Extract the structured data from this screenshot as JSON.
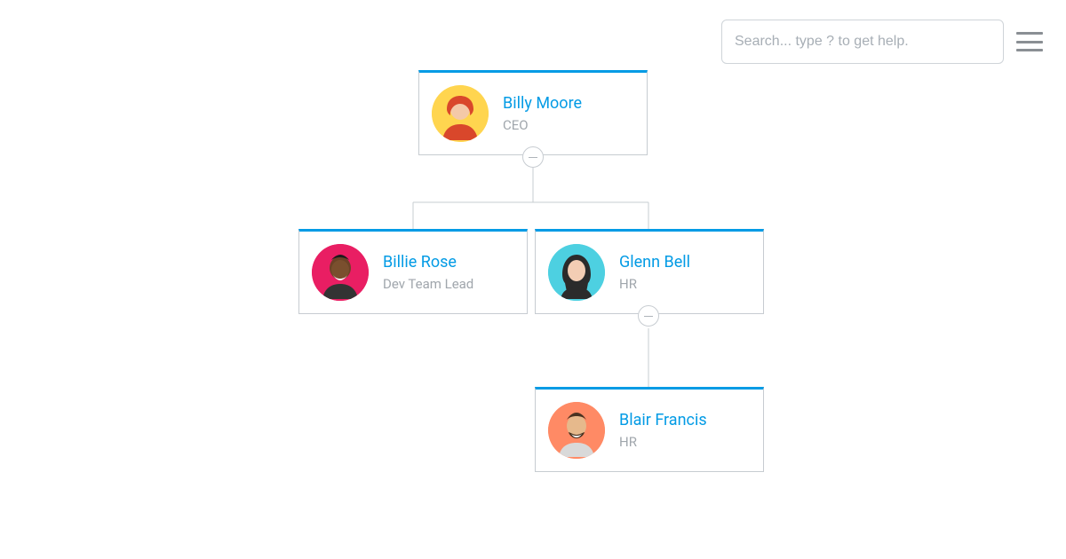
{
  "accent": "#039BE5",
  "search": {
    "placeholder": "Search... type ? to get help.",
    "value": ""
  },
  "avatar_colors": {
    "billy": "#FFD54F",
    "billie": "#E91E63",
    "glenn": "#4DD0E1",
    "blair": "#FF8A65"
  },
  "nodes": [
    {
      "id": "ceo",
      "name": "Billy Moore",
      "title": "CEO",
      "avatar": "billy"
    },
    {
      "id": "dev",
      "name": "Billie Rose",
      "title": "Dev Team Lead",
      "avatar": "billie"
    },
    {
      "id": "hr",
      "name": "Glenn Bell",
      "title": "HR",
      "avatar": "glenn"
    },
    {
      "id": "hr2",
      "name": "Blair Francis",
      "title": "HR",
      "avatar": "blair"
    }
  ]
}
